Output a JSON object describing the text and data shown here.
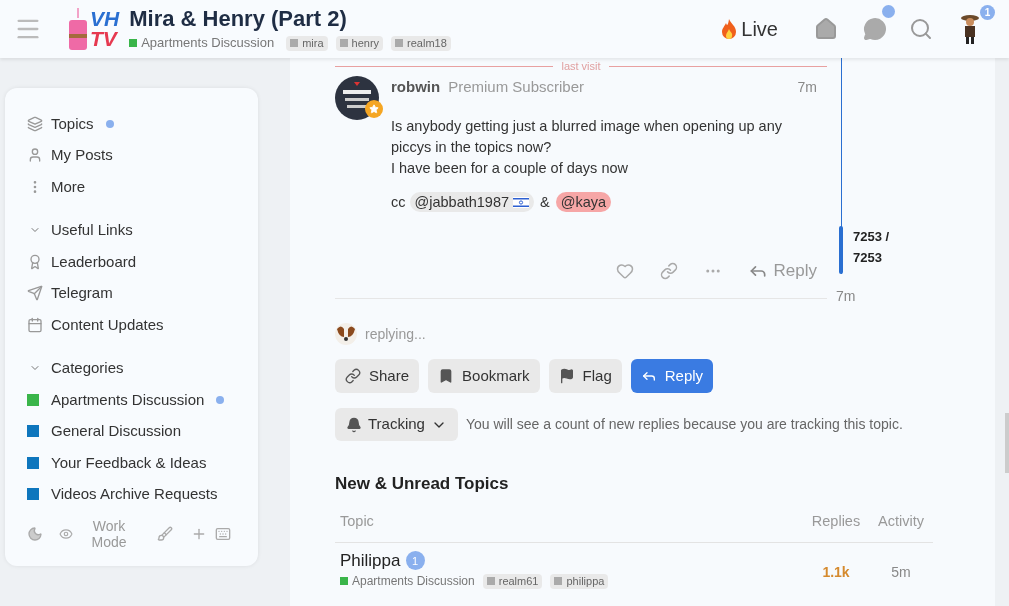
{
  "header": {
    "logo": [
      "VH",
      "TV"
    ],
    "title": "Mira & Henry (Part 2)",
    "category": {
      "name": "Apartments Discussion",
      "color": "#3ab54a"
    },
    "tags": [
      "mira",
      "henry",
      "realm18"
    ],
    "live": "Live",
    "chat_unread": true,
    "notifications": "1"
  },
  "sidebar": {
    "items": [
      {
        "kind": "topics",
        "label": "Topics",
        "unread": true
      },
      {
        "kind": "user",
        "label": "My Posts",
        "unread": false
      },
      {
        "kind": "more",
        "label": "More",
        "unread": false
      }
    ],
    "sections": [
      {
        "title": "Useful Links",
        "expanded": true,
        "links": [
          {
            "kind": "award",
            "label": "Leaderboard",
            "unread": false
          },
          {
            "kind": "send",
            "label": "Telegram",
            "unread": false
          },
          {
            "kind": "calendar",
            "label": "Content Updates",
            "unread": false
          }
        ]
      },
      {
        "title": "Categories",
        "expanded": true,
        "links": [
          {
            "kind": "category",
            "label": "Apartments Discussion",
            "color": "#3ab54a",
            "unread": true
          },
          {
            "kind": "category",
            "label": "General Discussion",
            "color": "#0e76bd",
            "unread": false
          },
          {
            "kind": "category",
            "label": "Your Feedback & Ideas",
            "color": "#0e76bd",
            "unread": false
          },
          {
            "kind": "category",
            "label": "Videos Archive Requests",
            "color": "#0e76bd",
            "unread": false
          }
        ]
      }
    ],
    "footer": {
      "mode_label": "Work Mode"
    }
  },
  "post": {
    "divider": "last visit",
    "author": "robwin",
    "title": "Premium Subscriber",
    "time": "7m",
    "lines": [
      "Is anybody getting just a blurred image when opening up any piccys in the topics now?",
      "I have been for a couple of days now"
    ],
    "cc": "cc",
    "amp": "&",
    "mentions": [
      {
        "name": "@jabbath1987",
        "kind": "plain"
      },
      {
        "name": "@kaya",
        "kind": "highlight"
      }
    ],
    "reply": "Reply"
  },
  "timeline": {
    "position": "7253 /",
    "total": "7253",
    "time": "7m"
  },
  "replying": "replying...",
  "actions": [
    {
      "kind": "share",
      "label": "Share",
      "primary": false
    },
    {
      "kind": "bookmark",
      "label": "Bookmark",
      "primary": false
    },
    {
      "kind": "flag",
      "label": "Flag",
      "primary": false
    },
    {
      "kind": "reply",
      "label": "Reply",
      "primary": true
    }
  ],
  "tracking": {
    "label": "Tracking",
    "description": "You will see a count of new replies because you are tracking this topic."
  },
  "topics": {
    "title": "New & Unread Topics",
    "columns": [
      "Topic",
      "Replies",
      "Activity"
    ],
    "rows": [
      {
        "title": "Philippa",
        "unread": "1",
        "category": {
          "name": "Apartments Discussion",
          "color": "#3ab54a"
        },
        "tags": [
          "realm61",
          "philippa"
        ],
        "replies": "1.1k",
        "activity": "5m"
      }
    ]
  }
}
